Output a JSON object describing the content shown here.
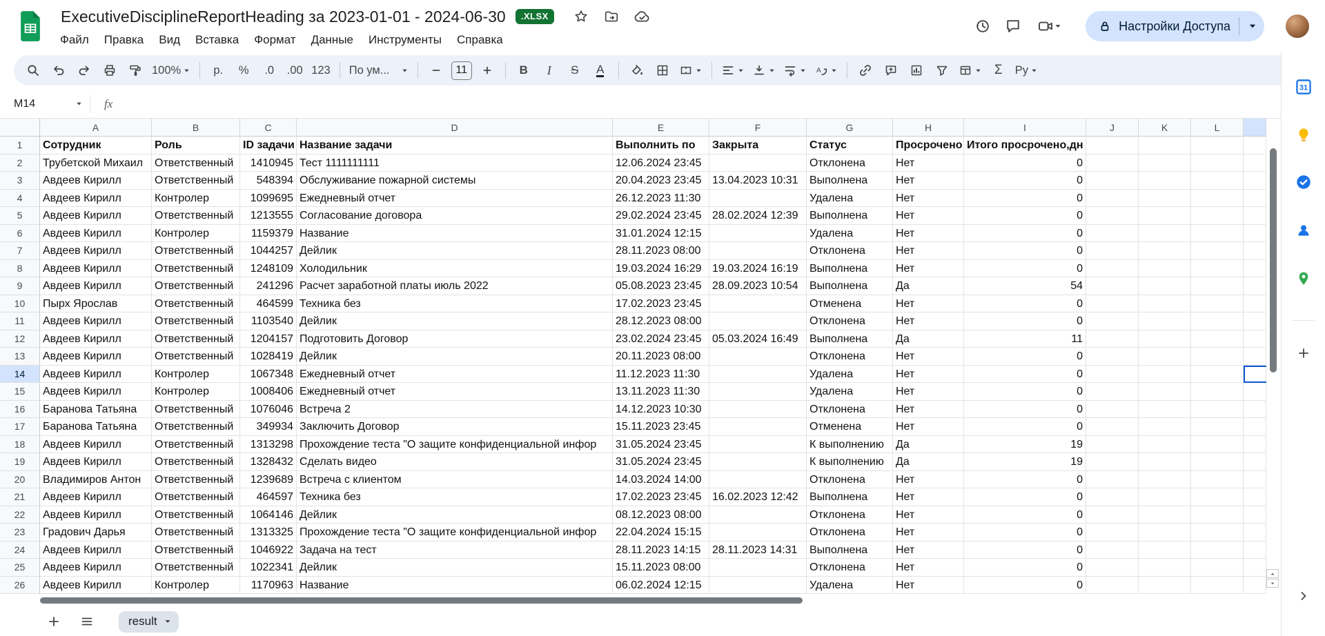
{
  "theme": {
    "brand_green": "#0f9d58",
    "badge_green": "#137333",
    "toolbar_bg": "#edf2fa",
    "share_pill_bg": "#d3e3fd",
    "share_pill_text": "#001d35",
    "selection_blue": "#0b57d0",
    "selected_header_bg": "#d3e3fd",
    "icon_gray": "#444746"
  },
  "header": {
    "title": "ExecutiveDisciplineReportHeading за 2023-01-01 - 2024-06-30",
    "file_badge": ".XLSX",
    "menu": [
      "Файл",
      "Правка",
      "Вид",
      "Вставка",
      "Формат",
      "Данные",
      "Инструменты",
      "Справка"
    ],
    "share_button": "Настройки Доступа"
  },
  "toolbar": {
    "zoom": "100%",
    "currency": "р.",
    "percent": "%",
    "decrease_decimal": ".0",
    "increase_decimal": ".00",
    "number_format": "123",
    "font_name": "По ум...",
    "font_size": "11",
    "bold": "B",
    "italic": "I",
    "strikethrough": "S",
    "text_color": "A",
    "functions": "Σ",
    "input_tools": "Ру"
  },
  "formula_bar": {
    "name_box": "M14",
    "fx_label": "fx",
    "formula": ""
  },
  "grid": {
    "columns": [
      "A",
      "B",
      "C",
      "D",
      "E",
      "F",
      "G",
      "H",
      "I",
      "J",
      "K",
      "L"
    ],
    "partial_column": "M",
    "header_row": [
      "Сотрудник",
      "Роль",
      "ID задачи",
      "Название задачи",
      "Выполнить по",
      "Закрыта",
      "Статус",
      "Просрочено",
      "Итого просрочено,дн"
    ],
    "rows": [
      [
        "Трубетской Михаил",
        "Ответственный",
        "1410945",
        "Тест 1111111111",
        "12.06.2024 23:45",
        "",
        "Отклонена",
        "Нет",
        "0"
      ],
      [
        "Авдеев Кирилл",
        "Ответственный",
        "548394",
        "Обслуживание пожарной системы",
        "20.04.2023 23:45",
        "13.04.2023 10:31",
        "Выполнена",
        "Нет",
        "0"
      ],
      [
        "Авдеев Кирилл",
        "Контролер",
        "1099695",
        "Ежедневный отчет",
        "26.12.2023 11:30",
        "",
        "Удалена",
        "Нет",
        "0"
      ],
      [
        "Авдеев Кирилл",
        "Ответственный",
        "1213555",
        "Согласование договора",
        "29.02.2024 23:45",
        "28.02.2024 12:39",
        "Выполнена",
        "Нет",
        "0"
      ],
      [
        "Авдеев Кирилл",
        "Контролер",
        "1159379",
        "Название",
        "31.01.2024 12:15",
        "",
        "Удалена",
        "Нет",
        "0"
      ],
      [
        "Авдеев Кирилл",
        "Ответственный",
        "1044257",
        "Дейлик",
        "28.11.2023 08:00",
        "",
        "Отклонена",
        "Нет",
        "0"
      ],
      [
        "Авдеев Кирилл",
        "Ответственный",
        "1248109",
        "Холодильник",
        "19.03.2024 16:29",
        "19.03.2024 16:19",
        "Выполнена",
        "Нет",
        "0"
      ],
      [
        "Авдеев Кирилл",
        "Ответственный",
        "241296",
        "Расчет заработной платы июль 2022",
        "05.08.2023 23:45",
        "28.09.2023 10:54",
        "Выполнена",
        "Да",
        "54"
      ],
      [
        "Пырх Ярослав",
        "Ответственный",
        "464599",
        "Техника без",
        "17.02.2023 23:45",
        "",
        "Отменена",
        "Нет",
        "0"
      ],
      [
        "Авдеев Кирилл",
        "Ответственный",
        "1103540",
        "Дейлик",
        "28.12.2023 08:00",
        "",
        "Отклонена",
        "Нет",
        "0"
      ],
      [
        "Авдеев Кирилл",
        "Ответственный",
        "1204157",
        "Подготовить Договор",
        "23.02.2024 23:45",
        "05.03.2024 16:49",
        "Выполнена",
        "Да",
        "11"
      ],
      [
        "Авдеев Кирилл",
        "Ответственный",
        "1028419",
        "Дейлик",
        "20.11.2023 08:00",
        "",
        "Отклонена",
        "Нет",
        "0"
      ],
      [
        "Авдеев Кирилл",
        "Контролер",
        "1067348",
        "Ежедневный отчет",
        "11.12.2023 11:30",
        "",
        "Удалена",
        "Нет",
        "0"
      ],
      [
        "Авдеев Кирилл",
        "Контролер",
        "1008406",
        "Ежедневный отчет",
        "13.11.2023 11:30",
        "",
        "Удалена",
        "Нет",
        "0"
      ],
      [
        "Баранова Татьяна",
        "Ответственный",
        "1076046",
        "Встреча 2",
        "14.12.2023 10:30",
        "",
        "Отклонена",
        "Нет",
        "0"
      ],
      [
        "Баранова Татьяна",
        "Ответственный",
        "349934",
        "Заключить Договор",
        "15.11.2023 23:45",
        "",
        "Отменена",
        "Нет",
        "0"
      ],
      [
        "Авдеев Кирилл",
        "Ответственный",
        "1313298",
        "Прохождение теста \"О защите конфиденциальной инфор",
        "31.05.2024 23:45",
        "",
        "К выполнению",
        "Да",
        "19"
      ],
      [
        "Авдеев Кирилл",
        "Ответственный",
        "1328432",
        "Сделать видео",
        "31.05.2024 23:45",
        "",
        "К выполнению",
        "Да",
        "19"
      ],
      [
        "Владимиров Антон",
        "Ответственный",
        "1239689",
        "Встреча с клиентом",
        "14.03.2024 14:00",
        "",
        "Отклонена",
        "Нет",
        "0"
      ],
      [
        "Авдеев Кирилл",
        "Ответственный",
        "464597",
        "Техника без",
        "17.02.2023 23:45",
        "16.02.2023 12:42",
        "Выполнена",
        "Нет",
        "0"
      ],
      [
        "Авдеев Кирилл",
        "Ответственный",
        "1064146",
        "Дейлик",
        "08.12.2023 08:00",
        "",
        "Отклонена",
        "Нет",
        "0"
      ],
      [
        "Градович Дарья",
        "Ответственный",
        "1313325",
        "Прохождение теста \"О защите конфиденциальной инфор",
        "22.04.2024 15:15",
        "",
        "Отклонена",
        "Нет",
        "0"
      ],
      [
        "Авдеев Кирилл",
        "Ответственный",
        "1046922",
        "Задача на тест",
        "28.11.2023 14:15",
        "28.11.2023 14:31",
        "Выполнена",
        "Нет",
        "0"
      ],
      [
        "Авдеев Кирилл",
        "Ответственный",
        "1022341",
        "Дейлик",
        "15.11.2023 08:00",
        "",
        "Отклонена",
        "Нет",
        "0"
      ],
      [
        "Авдеев Кирилл",
        "Контролер",
        "1170963",
        "Название",
        "06.02.2024 12:15",
        "",
        "Удалена",
        "Нет",
        "0"
      ]
    ],
    "selection": {
      "cell": "M14",
      "row": 14,
      "column": "M"
    }
  },
  "sheet_bar": {
    "active_tab": "result"
  },
  "side_panel": {
    "calendar_label": "31"
  }
}
